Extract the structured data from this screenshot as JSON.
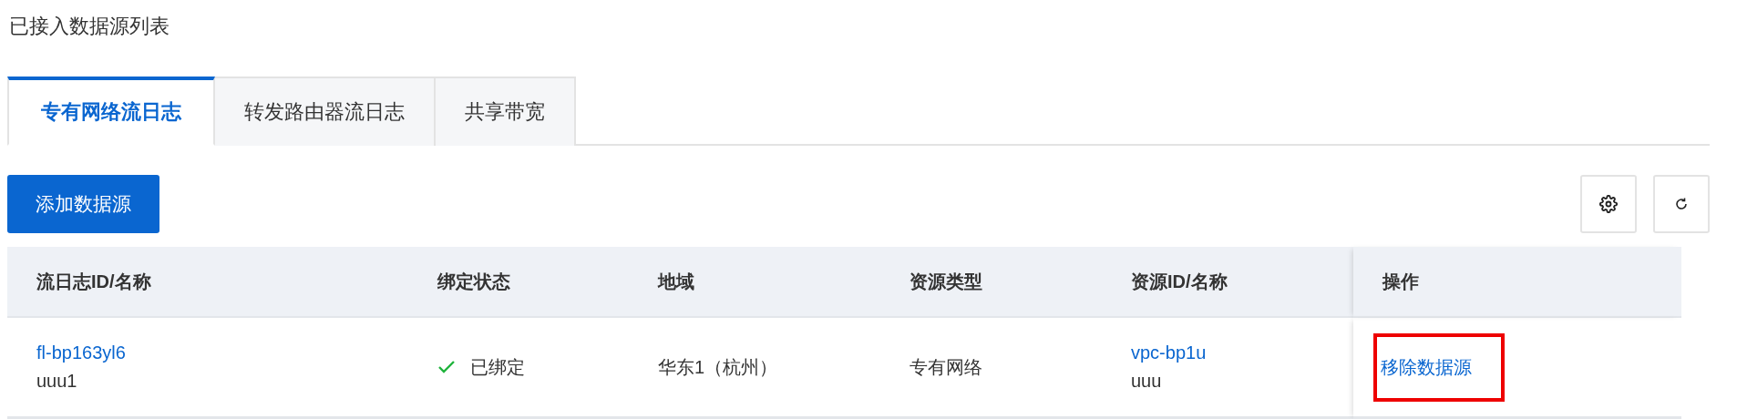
{
  "title": "已接入数据源列表",
  "tabs": [
    {
      "label": "专有网络流日志",
      "selected": true
    },
    {
      "label": "转发路由器流日志",
      "selected": false
    },
    {
      "label": "共享带宽",
      "selected": false
    }
  ],
  "toolbar": {
    "add_button": "添加数据源"
  },
  "table": {
    "columns": [
      "流日志ID/名称",
      "绑定状态",
      "地域",
      "资源类型",
      "资源ID/名称",
      "操作"
    ],
    "rows": [
      {
        "flow_log_id": "fl-bp163yl6",
        "flow_log_name": "uuu1",
        "status": "已绑定",
        "bound": true,
        "region": "华东1（杭州）",
        "resource_type": "专有网络",
        "resource_id": "vpc-bp1u",
        "resource_name": "uuu",
        "action": "移除数据源",
        "highlighted": true
      }
    ]
  }
}
